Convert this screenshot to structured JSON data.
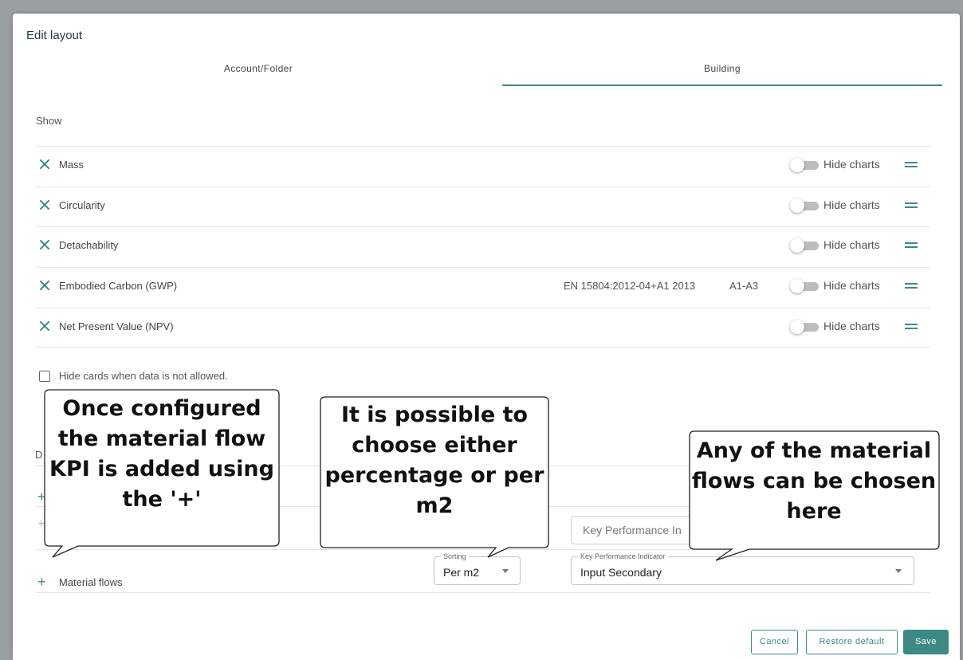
{
  "dialog": {
    "title": "Edit layout",
    "tabs": [
      {
        "label": "Account/Folder",
        "active": false
      },
      {
        "label": "Building",
        "active": true
      }
    ],
    "accent_color": "#3d8a85"
  },
  "show_section": {
    "heading": "Show",
    "rows": [
      {
        "label": "Mass",
        "standard": "",
        "phase": "",
        "toggle_label": "Hide charts",
        "toggle_on": false
      },
      {
        "label": "Circularity",
        "standard": "",
        "phase": "",
        "toggle_label": "Hide charts",
        "toggle_on": false
      },
      {
        "label": "Detachability",
        "standard": "",
        "phase": "",
        "toggle_label": "Hide charts",
        "toggle_on": false
      },
      {
        "label": "Embodied Carbon (GWP)",
        "standard": "EN 15804:2012-04+A1 2013",
        "phase": "A1-A3",
        "toggle_label": "Hide charts",
        "toggle_on": false
      },
      {
        "label": "Net Present Value (NPV)",
        "standard": "",
        "phase": "",
        "toggle_label": "Hide charts",
        "toggle_on": false
      }
    ]
  },
  "hide_cards_checkbox": {
    "label": "Hide cards when data is not allowed.",
    "checked": false
  },
  "hidden_section": {
    "heading_fragment": "D",
    "ghost_kpi_placeholder": "Key Performance In"
  },
  "material_flows_row": {
    "label": "Material flows",
    "sorting": {
      "legend": "Sorting",
      "value": "Per m2"
    },
    "kpi": {
      "legend": "Key Performance Indicator",
      "value": "Input Secondary"
    }
  },
  "footer": {
    "cancel": "Cancel",
    "restore": "Restore default",
    "save": "Save"
  },
  "callouts": [
    {
      "text": "Once configured the material flow KPI is added using the '+'"
    },
    {
      "text": "It is possible to choose either percentage or per m2"
    },
    {
      "text": "Any of the material flows can be chosen here"
    }
  ]
}
